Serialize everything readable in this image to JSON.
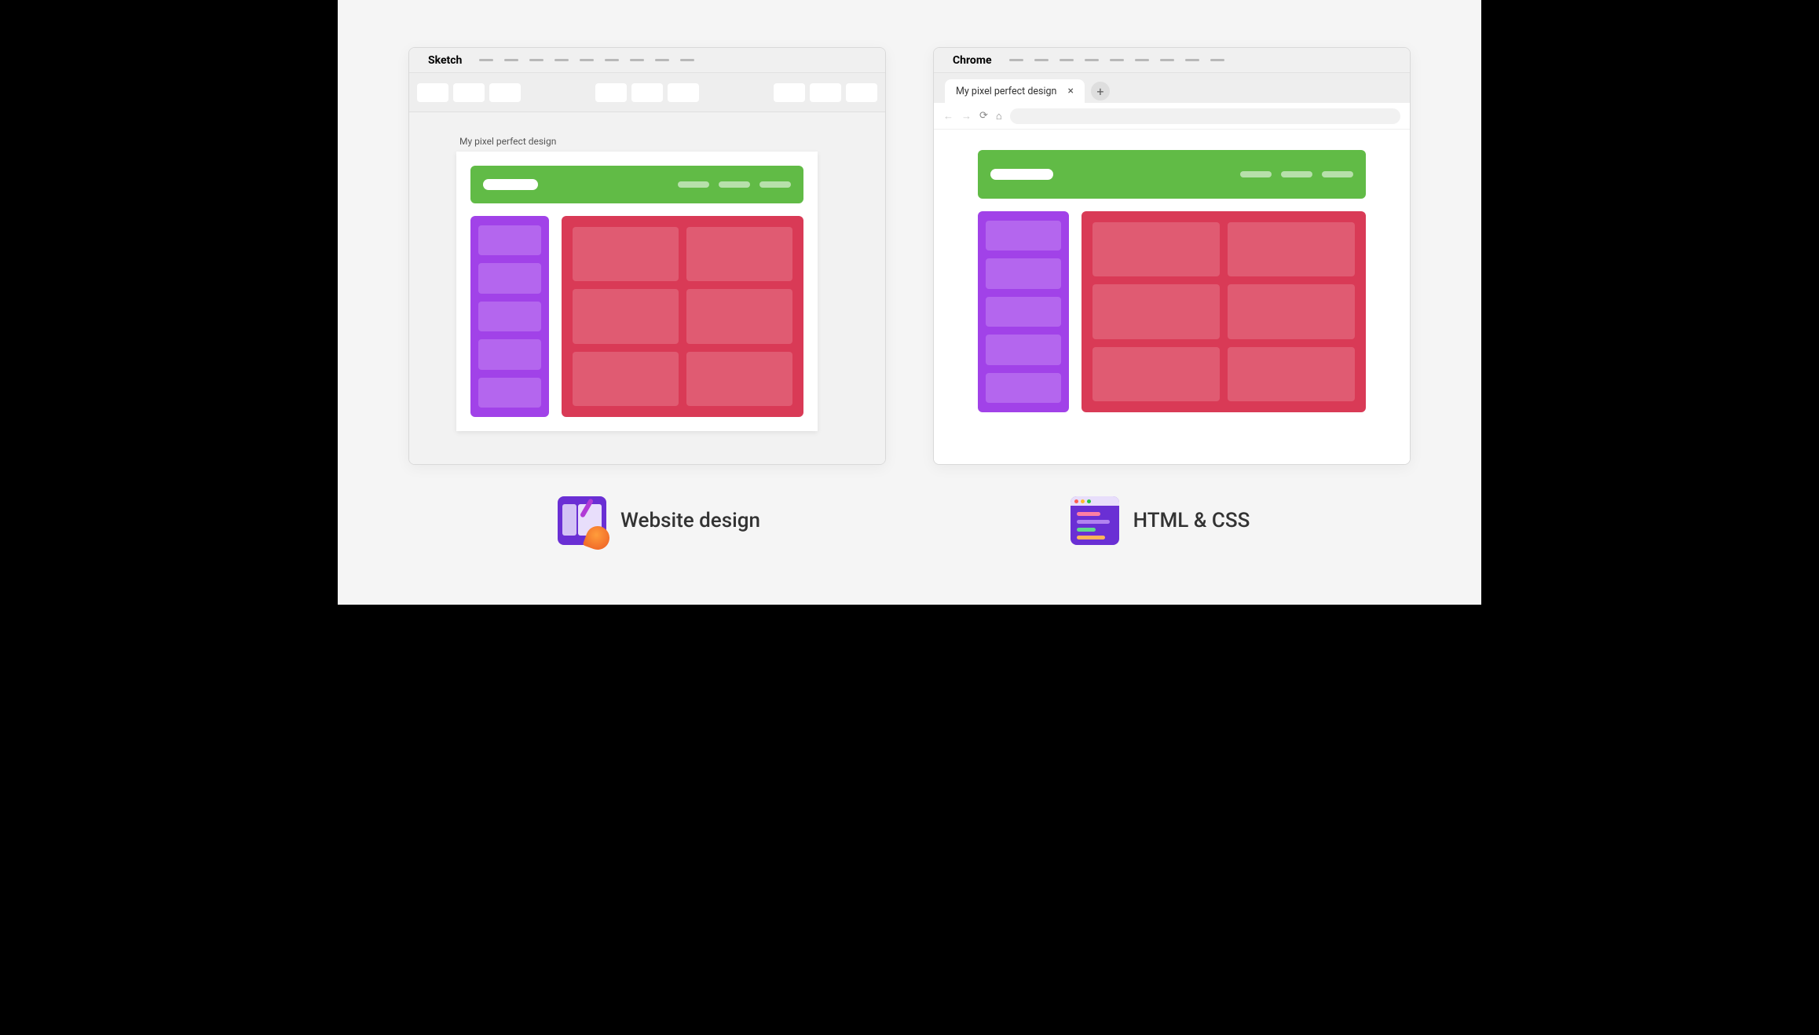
{
  "left": {
    "app_name": "Sketch",
    "artboard_label": "My pixel perfect design",
    "caption": "Website design"
  },
  "right": {
    "app_name": "Chrome",
    "tab_title": "My pixel perfect design",
    "caption": "HTML & CSS"
  },
  "colors": {
    "header": "#61bb46",
    "sidebar": "#a142e8",
    "main": "#d93a56"
  }
}
